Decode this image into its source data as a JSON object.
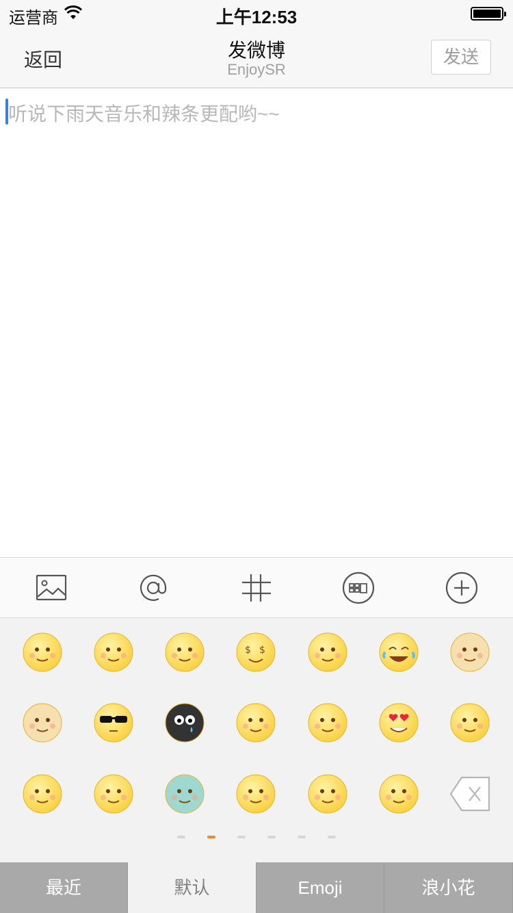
{
  "status_bar": {
    "carrier": "运营商",
    "time": "上午12:53"
  },
  "nav": {
    "back_label": "返回",
    "title": "发微博",
    "subtitle": "EnjoySR",
    "send_label": "发送"
  },
  "editor": {
    "placeholder": "听说下雨天音乐和辣条更配哟~~"
  },
  "toolbar": {
    "items": [
      {
        "icon": "picture-icon"
      },
      {
        "icon": "mention-icon"
      },
      {
        "icon": "hashtag-icon"
      },
      {
        "icon": "emoticon-keyboard-icon"
      },
      {
        "icon": "add-icon"
      }
    ]
  },
  "emoji_grid": {
    "rows": [
      [
        "sweat-emoji",
        "shy-emoji",
        "sleepy-drool-emoji",
        "money-emoji",
        "thinking-emoji",
        "laugh-cry-emoji",
        "doge-emoji"
      ],
      [
        "cat-emoji",
        "cool-sunglasses-emoji",
        "black-face-emoji",
        "silence-emoji",
        "hum-emoji",
        "heart-eyes-emoji",
        "pray-emoji"
      ],
      [
        "pitiful-emoji",
        "hmm-emoji",
        "sick-emoji",
        "kiss-emoji",
        "angry-shout-emoji",
        "happy-emoji",
        "delete-key"
      ]
    ]
  },
  "page_indicator": {
    "pages": 6,
    "current": 2
  },
  "tabs": [
    {
      "label": "最近",
      "active": false
    },
    {
      "label": "默认",
      "active": true
    },
    {
      "label": "Emoji",
      "active": false
    },
    {
      "label": "浪小花",
      "active": false
    }
  ],
  "colors": {
    "accent": "#f08a24",
    "caret": "#3a7bf6",
    "emoji_yellow": "#f9cf3a"
  }
}
